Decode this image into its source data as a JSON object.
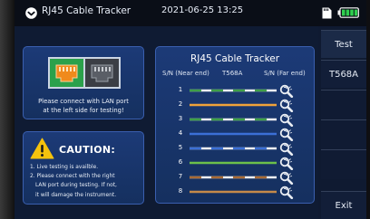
{
  "titlebar": {
    "app_title": "RJ45 Cable Tracker",
    "datetime": "2021-06-25 13:25",
    "icons": [
      "home-icon",
      "sd-card-icon",
      "battery-icon"
    ]
  },
  "connect_panel": {
    "message_line1": "Please connect with LAN port",
    "message_line2": "at the left side for testing!"
  },
  "caution": {
    "title": "CAUTION:",
    "lines": [
      "1. Live testing is availble.",
      "2. Please connect with the right",
      "LAN port during testing. If not,",
      "it will damage the instrument."
    ]
  },
  "tracker": {
    "title": "RJ45 Cable Tracker",
    "col_near": "S/N (Near end)",
    "col_standard": "T568A",
    "col_far": "S/N (Far end)",
    "pins": [
      "1",
      "2",
      "3",
      "4",
      "5",
      "6",
      "7",
      "8"
    ],
    "wire_colors": [
      {
        "base": "#f2f2f2",
        "stripe": "#3f9f48"
      },
      {
        "base": "#f0a23a",
        "stripe": null
      },
      {
        "base": "#f2f2f2",
        "stripe": "#3f9f48"
      },
      {
        "base": "#3b6fd6",
        "stripe": null
      },
      {
        "base": "#f2f2f2",
        "stripe": "#3b6fd6"
      },
      {
        "base": "#6cc04a",
        "stripe": null
      },
      {
        "base": "#f2f2f2",
        "stripe": "#a86b35"
      },
      {
        "base": "#c58a4a",
        "stripe": null
      }
    ]
  },
  "side_menu": {
    "buttons": [
      "Test",
      "T568A",
      "Exit"
    ]
  },
  "colors": {
    "panel_bg": "#1c3a77",
    "panel_border": "#3a5faf",
    "screen_bg": "#0f1b33",
    "active_port": "#2ba14b",
    "warning": "#f4c20d"
  }
}
